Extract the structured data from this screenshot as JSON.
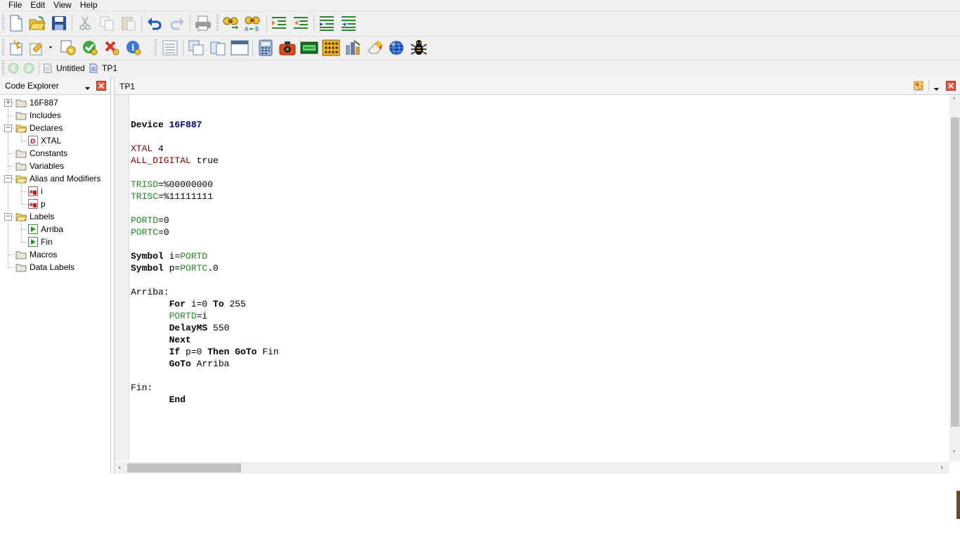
{
  "menu": [
    "File",
    "Edit",
    "View",
    "Help"
  ],
  "toolbar1": [
    "new-file-icon",
    "open-folder-icon",
    "save-icon",
    "cut-icon",
    "copy-icon",
    "paste-icon",
    "undo-icon",
    "redo-icon",
    "print-icon",
    "find-icon",
    "replace-icon",
    "indent-icon",
    "outdent-icon",
    "comment-icon",
    "uncomment-icon"
  ],
  "toolbar2": [
    "new-project-icon",
    "compile-dropdown-icon",
    "compile-settings-icon",
    "compile-ok-icon",
    "compile-cancel-icon",
    "info-icon",
    "list-view-icon",
    "window-cascade-icon",
    "window-tile-icon",
    "window-icon",
    "calculator-icon",
    "programmer-icon",
    "lcd-icon",
    "led-matrix-icon",
    "tools-icon",
    "eraser-icon",
    "globe-icon",
    "bug-icon"
  ],
  "nav": {
    "back": "back-icon",
    "forward": "forward-icon",
    "tabs": [
      "Untitled",
      "TP1"
    ]
  },
  "explorer": {
    "title": "Code Explorer",
    "items": [
      {
        "label": "16F887",
        "level": 0,
        "expander": "+",
        "icon": "folder"
      },
      {
        "label": "Includes",
        "level": 0,
        "expander": "",
        "icon": "folder"
      },
      {
        "label": "Declares",
        "level": 0,
        "expander": "-",
        "icon": "folder-open"
      },
      {
        "label": "XTAL",
        "level": 1,
        "expander": "",
        "icon": "declare",
        "badge": "D"
      },
      {
        "label": "Constants",
        "level": 0,
        "expander": "",
        "icon": "folder"
      },
      {
        "label": "Variables",
        "level": 0,
        "expander": "",
        "icon": "folder"
      },
      {
        "label": "Alias and Modifiers",
        "level": 0,
        "expander": "-",
        "icon": "folder-open"
      },
      {
        "label": "i",
        "level": 1,
        "expander": "",
        "icon": "alias"
      },
      {
        "label": "p",
        "level": 1,
        "expander": "",
        "icon": "alias"
      },
      {
        "label": "Labels",
        "level": 0,
        "expander": "-",
        "icon": "folder-open"
      },
      {
        "label": "Arriba",
        "level": 1,
        "expander": "",
        "icon": "label"
      },
      {
        "label": "Fin",
        "level": 1,
        "expander": "",
        "icon": "label"
      },
      {
        "label": "Macros",
        "level": 0,
        "expander": "",
        "icon": "folder"
      },
      {
        "label": "Data Labels",
        "level": 0,
        "expander": "",
        "icon": "folder"
      }
    ]
  },
  "editor": {
    "tab": "TP1",
    "lines": [
      [],
      [
        [
          "kw",
          "Device "
        ],
        [
          "num",
          "16F887"
        ]
      ],
      [],
      [
        [
          "red",
          "XTAL "
        ],
        [
          "plain",
          "4"
        ]
      ],
      [
        [
          "red",
          "ALL_DIGITAL "
        ],
        [
          "plain",
          "true"
        ]
      ],
      [],
      [
        [
          "grn",
          "TRISD"
        ],
        [
          "plain",
          "=%00000000"
        ]
      ],
      [
        [
          "grn",
          "TRISC"
        ],
        [
          "plain",
          "=%11111111"
        ]
      ],
      [],
      [
        [
          "grn",
          "PORTD"
        ],
        [
          "plain",
          "=0"
        ]
      ],
      [
        [
          "grn",
          "PORTC"
        ],
        [
          "plain",
          "=0"
        ]
      ],
      [],
      [
        [
          "kw",
          "Symbol "
        ],
        [
          "plain",
          "i="
        ],
        [
          "grn",
          "PORTD"
        ]
      ],
      [
        [
          "kw",
          "Symbol "
        ],
        [
          "plain",
          "p="
        ],
        [
          "grn",
          "PORTC"
        ],
        [
          "plain",
          ".0"
        ]
      ],
      [],
      [
        [
          "plain",
          "Arriba:"
        ]
      ],
      [
        [
          "plain",
          "       "
        ],
        [
          "kw",
          "For "
        ],
        [
          "plain",
          "i=0 "
        ],
        [
          "kw",
          "To "
        ],
        [
          "plain",
          "255"
        ]
      ],
      [
        [
          "plain",
          "       "
        ],
        [
          "grn",
          "PORTD"
        ],
        [
          "plain",
          "=i"
        ]
      ],
      [
        [
          "plain",
          "       "
        ],
        [
          "kw",
          "DelayMS "
        ],
        [
          "plain",
          "550"
        ]
      ],
      [
        [
          "plain",
          "       "
        ],
        [
          "kw",
          "Next"
        ]
      ],
      [
        [
          "plain",
          "       "
        ],
        [
          "kw",
          "If "
        ],
        [
          "plain",
          "p=0 "
        ],
        [
          "kw",
          "Then GoTo "
        ],
        [
          "plain",
          "Fin"
        ]
      ],
      [
        [
          "plain",
          "       "
        ],
        [
          "kw",
          "GoTo "
        ],
        [
          "plain",
          "Arriba"
        ]
      ],
      [],
      [
        [
          "plain",
          "Fin:"
        ]
      ],
      [
        [
          "plain",
          "       "
        ],
        [
          "kw",
          "End"
        ]
      ]
    ]
  }
}
